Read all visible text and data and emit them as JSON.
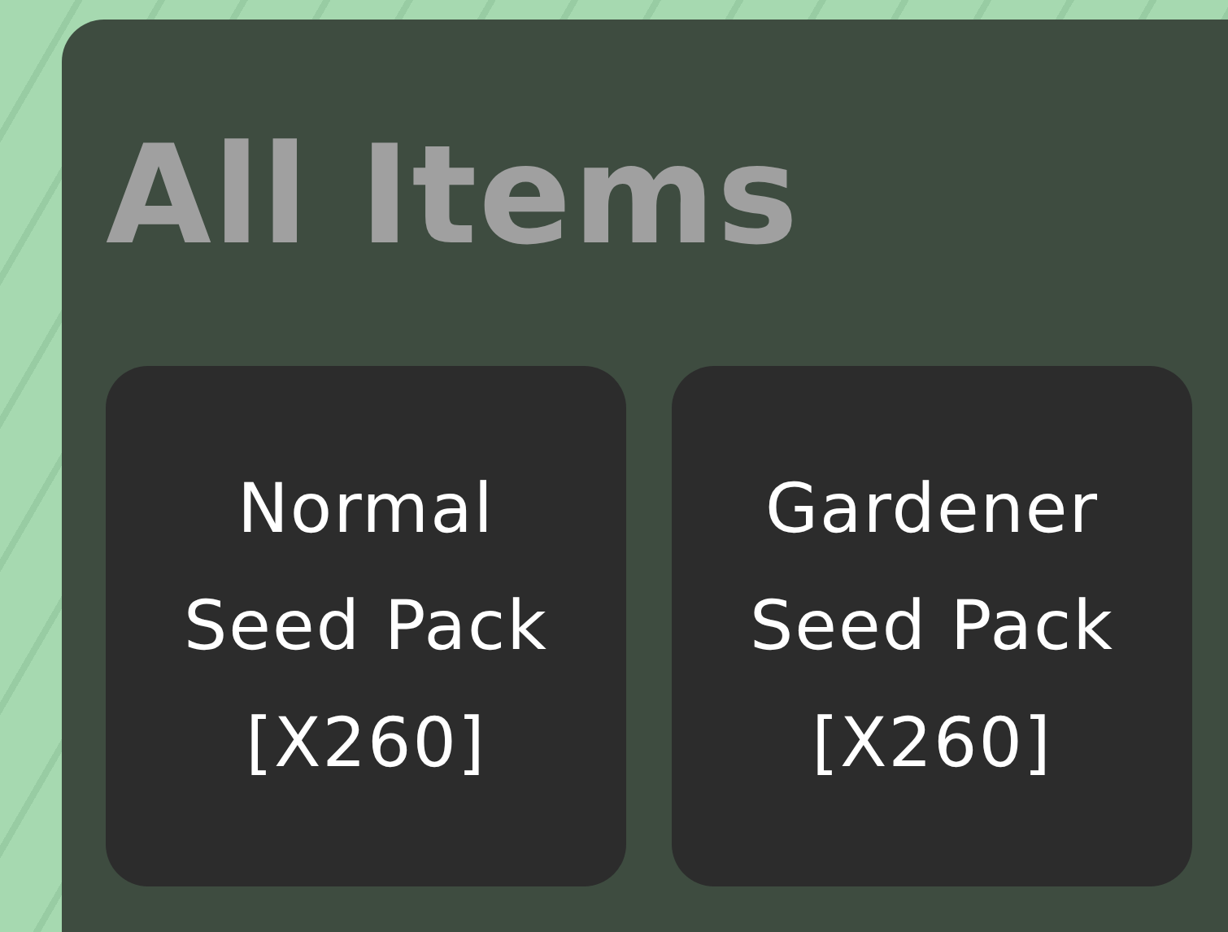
{
  "panel": {
    "title": "All Items"
  },
  "items": [
    {
      "lines": [
        "Normal",
        "Seed Pack",
        "[X260]"
      ]
    },
    {
      "lines": [
        "Gardener",
        "Seed Pack",
        "[X260]"
      ]
    }
  ]
}
